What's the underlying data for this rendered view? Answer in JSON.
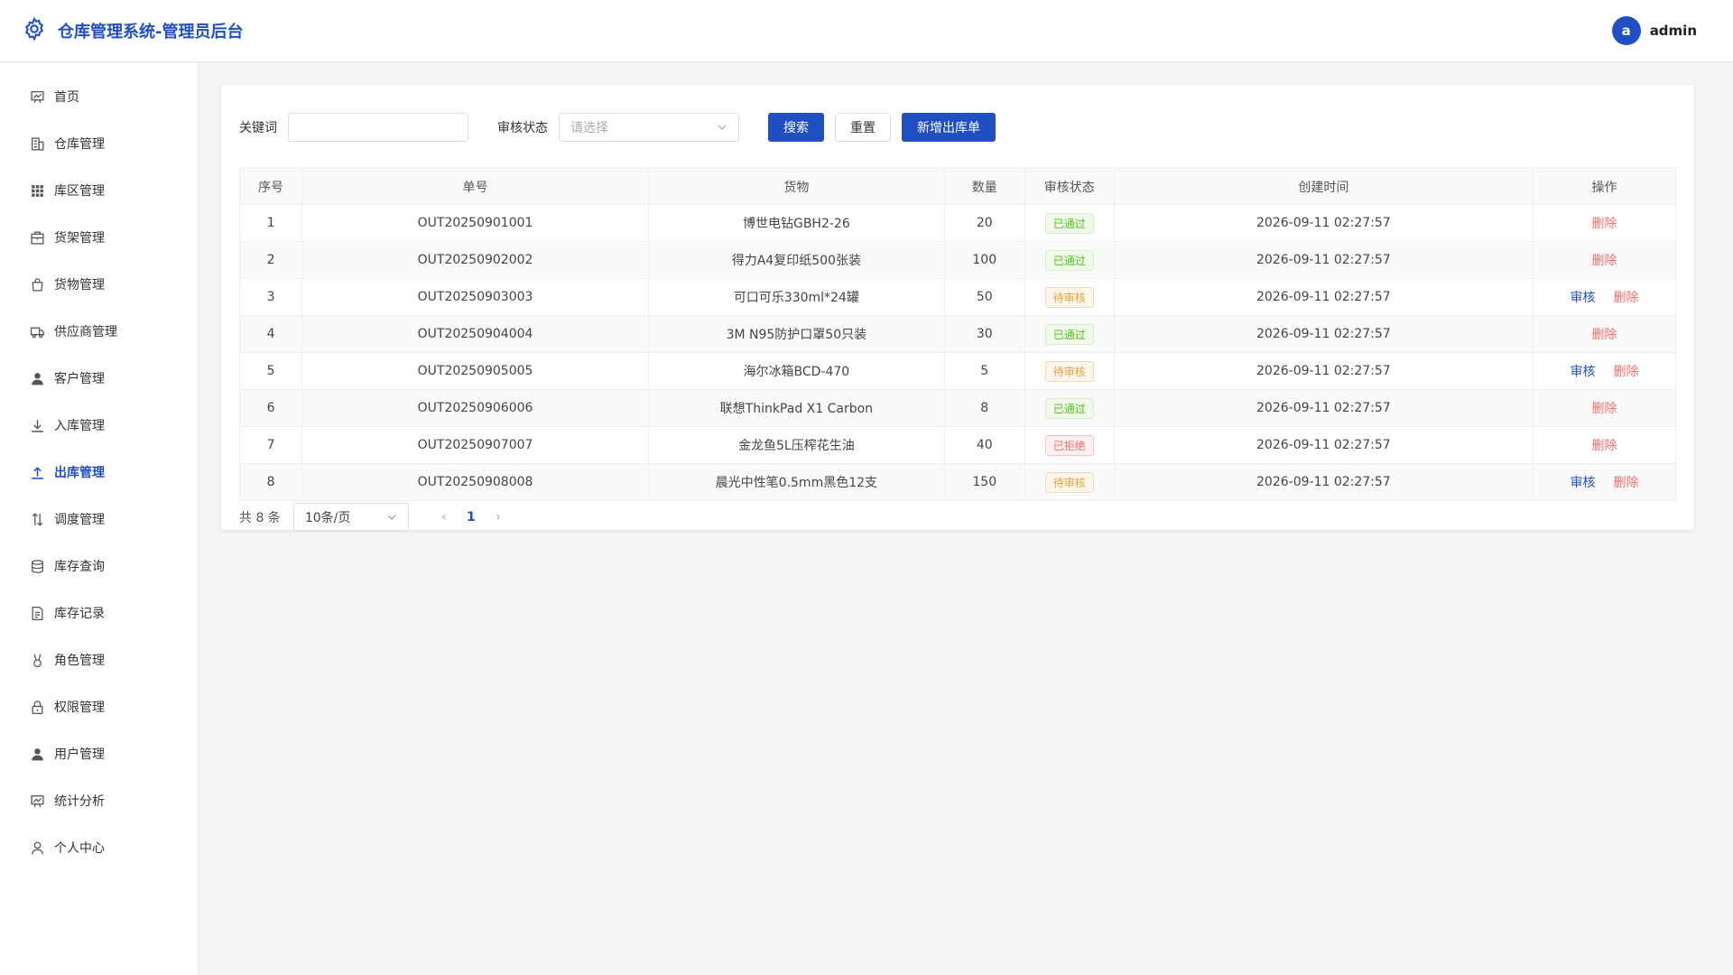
{
  "header": {
    "title": "仓库管理系统-管理员后台",
    "avatar_letter": "a",
    "username": "admin"
  },
  "sidebar": {
    "items": [
      {
        "label": "首页",
        "icon": "dashboard-icon"
      },
      {
        "label": "仓库管理",
        "icon": "building-icon"
      },
      {
        "label": "库区管理",
        "icon": "grid-icon"
      },
      {
        "label": "货架管理",
        "icon": "shelf-icon"
      },
      {
        "label": "货物管理",
        "icon": "bag-icon"
      },
      {
        "label": "供应商管理",
        "icon": "truck-icon"
      },
      {
        "label": "客户管理",
        "icon": "person-icon"
      },
      {
        "label": "入库管理",
        "icon": "download-icon"
      },
      {
        "label": "出库管理",
        "icon": "upload-icon"
      },
      {
        "label": "调度管理",
        "icon": "swap-icon"
      },
      {
        "label": "库存查询",
        "icon": "database-icon"
      },
      {
        "label": "库存记录",
        "icon": "document-icon"
      },
      {
        "label": "角色管理",
        "icon": "role-icon"
      },
      {
        "label": "权限管理",
        "icon": "lock-icon"
      },
      {
        "label": "用户管理",
        "icon": "user-icon"
      },
      {
        "label": "统计分析",
        "icon": "chart-icon"
      },
      {
        "label": "个人中心",
        "icon": "profile-icon"
      }
    ],
    "active_index": 8
  },
  "filters": {
    "keyword_label": "关键词",
    "keyword_value": "",
    "status_label": "审核状态",
    "status_placeholder": "请选择",
    "search_label": "搜索",
    "reset_label": "重置",
    "add_label": "新增出库单"
  },
  "table": {
    "headers": [
      "序号",
      "单号",
      "货物",
      "数量",
      "审核状态",
      "创建时间",
      "操作"
    ],
    "rows": [
      {
        "no": "1",
        "order": "OUT20250901001",
        "goods": "博世电钻GBH2-26",
        "qty": "20",
        "status": "已通过",
        "status_type": "ok",
        "time": "2026-09-11 02:27:57"
      },
      {
        "no": "2",
        "order": "OUT20250902002",
        "goods": "得力A4复印纸500张装",
        "qty": "100",
        "status": "已通过",
        "status_type": "ok",
        "time": "2026-09-11 02:27:57"
      },
      {
        "no": "3",
        "order": "OUT20250903003",
        "goods": "可口可乐330ml*24罐",
        "qty": "50",
        "status": "待审核",
        "status_type": "pending",
        "time": "2026-09-11 02:27:57"
      },
      {
        "no": "4",
        "order": "OUT20250904004",
        "goods": "3M N95防护口罩50只装",
        "qty": "30",
        "status": "已通过",
        "status_type": "ok",
        "time": "2026-09-11 02:27:57"
      },
      {
        "no": "5",
        "order": "OUT20250905005",
        "goods": "海尔冰箱BCD-470",
        "qty": "5",
        "status": "待审核",
        "status_type": "pending",
        "time": "2026-09-11 02:27:57"
      },
      {
        "no": "6",
        "order": "OUT20250906006",
        "goods": "联想ThinkPad X1 Carbon",
        "qty": "8",
        "status": "已通过",
        "status_type": "ok",
        "time": "2026-09-11 02:27:57"
      },
      {
        "no": "7",
        "order": "OUT20250907007",
        "goods": "金龙鱼5L压榨花生油",
        "qty": "40",
        "status": "已拒绝",
        "status_type": "rejected",
        "time": "2026-09-11 02:27:57"
      },
      {
        "no": "8",
        "order": "OUT20250908008",
        "goods": "晨光中性笔0.5mm黑色12支",
        "qty": "150",
        "status": "待审核",
        "status_type": "pending",
        "time": "2026-09-11 02:27:57"
      }
    ],
    "audit_label": "审核",
    "delete_label": "删除"
  },
  "pagination": {
    "total_text": "共 8 条",
    "page_size": "10条/页",
    "current_page": "1"
  },
  "colors": {
    "primary": "#1f4fc1",
    "danger": "#f56c6c",
    "success": "#52c41a",
    "warning": "#e6a23c"
  }
}
